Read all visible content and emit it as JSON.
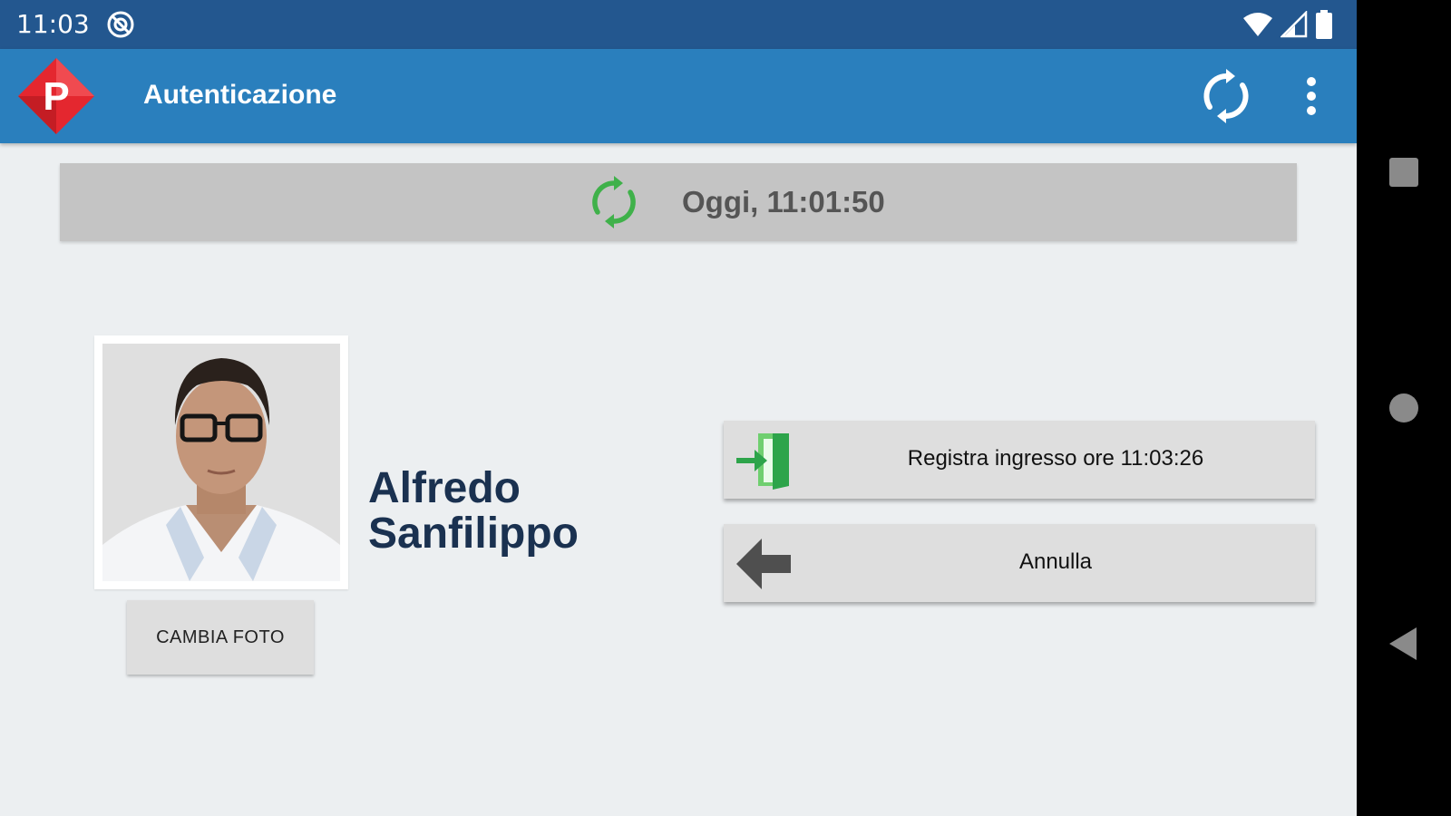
{
  "status_bar": {
    "time": "11:03",
    "icons": [
      "do-not-disturb-icon",
      "wifi-icon",
      "signal-icon",
      "battery-icon"
    ]
  },
  "app_bar": {
    "logo_letter": "P",
    "title": "Autenticazione",
    "actions": [
      "sync-icon",
      "more-vert-icon"
    ]
  },
  "sync_status": {
    "text": "Oggi, 11:01:50",
    "icon": "sync-icon"
  },
  "user": {
    "name_first": "Alfredo",
    "name_last": "Sanfilippo",
    "change_photo_label": "CAMBIA FOTO"
  },
  "actions": {
    "register_entry_label": "Registra ingresso ore 11:03:26",
    "cancel_label": "Annulla"
  },
  "navigation": {
    "buttons": [
      "recents-icon",
      "home-icon",
      "back-icon"
    ]
  },
  "colors": {
    "status_bar": "#23578f",
    "app_bar": "#2a7fbd",
    "logo_red": "#e4272f",
    "sync_green": "#3fb14a",
    "name_color": "#1a3150",
    "background": "#eceff1"
  }
}
